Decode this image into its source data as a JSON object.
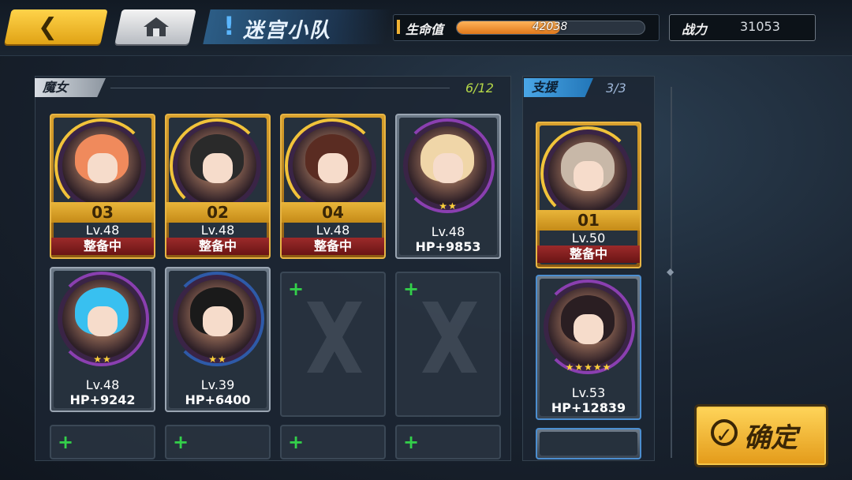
{
  "header": {
    "title": "迷宫小队",
    "hp_label": "生命值",
    "hp_value": "42038",
    "hp_fraction": 0.55,
    "power_label": "战力",
    "power_value": "31053"
  },
  "witch_section": {
    "tab_label": "魔女",
    "count": "6/12",
    "cards": [
      {
        "order": "03",
        "level": "Lv.48",
        "status": "整备中",
        "hair": "#f08a5c"
      },
      {
        "order": "02",
        "level": "Lv.48",
        "status": "整备中",
        "hair": "#2a2a2a"
      },
      {
        "order": "04",
        "level": "Lv.48",
        "status": "整备中",
        "hair": "#5a2c22"
      },
      {
        "level": "Lv.48",
        "status": "HP+9853",
        "hair": "#f0d6a8"
      },
      {
        "level": "Lv.48",
        "status": "HP+9242",
        "hair": "#38c0f0"
      },
      {
        "level": "Lv.39",
        "status": "HP+6400",
        "hair": "#1a1a1a"
      }
    ]
  },
  "support_section": {
    "tab_label": "支援",
    "count": "3/3",
    "cards": [
      {
        "order": "01",
        "level": "Lv.50",
        "status": "整备中",
        "hair": "#c8b8a8"
      },
      {
        "level": "Lv.53",
        "status": "HP+12839",
        "hair": "#2a1e22"
      }
    ]
  },
  "confirm_label": "确定"
}
